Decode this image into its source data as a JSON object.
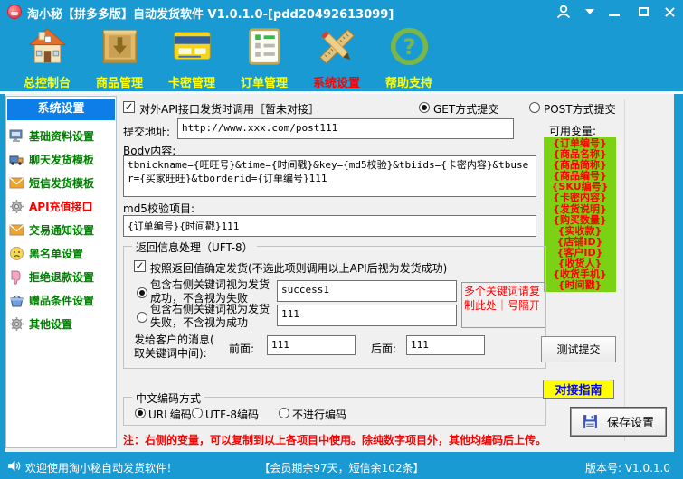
{
  "colors": {
    "titlebar_blue": "#199ad3",
    "sidebar_header_blue": "#0d7ee8",
    "variables_green": "#7bd114",
    "variable_text_red": "#ff0000",
    "nav_label_yellow": "#ffff00",
    "nav_selected_red": "#ff0000",
    "sidebar_item_green": "#008000",
    "guide_button_yellow": "#ffff00",
    "guide_button_text_blue": "#0000ff"
  },
  "window": {
    "title": "淘小秘【拼多多版】自动发货软件 V1.0.1.0-[pdd20492613099]"
  },
  "toolbar": {
    "items": [
      {
        "label": "总控制台",
        "icon": "home-icon",
        "selected": false
      },
      {
        "label": "商品管理",
        "icon": "goods-box-icon",
        "selected": false
      },
      {
        "label": "卡密管理",
        "icon": "card-icon",
        "selected": false
      },
      {
        "label": "订单管理",
        "icon": "order-list-icon",
        "selected": false
      },
      {
        "label": "系统设置",
        "icon": "tools-icon",
        "selected": true
      },
      {
        "label": "帮助支持",
        "icon": "help-icon",
        "selected": false
      }
    ]
  },
  "sidebar": {
    "header": "系统设置",
    "items": [
      {
        "label": "基础资料设置",
        "icon": "monitor-icon",
        "selected": false
      },
      {
        "label": "聊天发货模板",
        "icon": "truck-icon",
        "selected": false
      },
      {
        "label": "短信发货模板",
        "icon": "sms-envelope-icon",
        "selected": false
      },
      {
        "label": "API充值接口",
        "icon": "gear-icon",
        "selected": true
      },
      {
        "label": "交易通知设置",
        "icon": "notify-envelope-icon",
        "selected": false
      },
      {
        "label": "黑名单设置",
        "icon": "blacklist-face-icon",
        "selected": false
      },
      {
        "label": "拒绝退款设置",
        "icon": "thumbs-down-icon",
        "selected": false
      },
      {
        "label": "赠品条件设置",
        "icon": "gift-basket-icon",
        "selected": false
      },
      {
        "label": "其他设置",
        "icon": "gear-icon",
        "selected": false
      }
    ]
  },
  "content": {
    "api_checkbox_label": "对外API接口发货时调用［暂未对接］",
    "get_radio_label": "GET方式提交",
    "post_radio_label": "POST方式提交",
    "submit_address_label": "提交地址:",
    "submit_address_value": "http://www.xxx.com/post111",
    "variables_label": "可用变量:",
    "variables": [
      "{订单编号}",
      "{商品名称}",
      "{商品简称}",
      "{商品编号}",
      "{SKU编号}",
      "{卡密内容}",
      "{发货说明}",
      "{购买数量}",
      "{实收款}",
      "{店铺ID}",
      "{客户ID}",
      "{收货人}",
      "{收货手机}",
      "{时间戳}"
    ],
    "body_label": "Body内容:",
    "body_value": "tbnickname={旺旺号}&time={时间戳}&key={md5校验}&tbiids={卡密内容}&tbuser={买家旺旺}&tborderid={订单编号}111",
    "md5_label": "md5校验项目:",
    "md5_value": "{订单编号}{时间戳}111",
    "return_group": {
      "title": "返回信息处理（UFT-8）",
      "confirm_checkbox_label": "按照返回值确定发货(不选此项则调用以上API后视为发货成功)",
      "success_radio_line1": "包含右侧关键词视为发货",
      "success_radio_line2": "成功，不含视为失败",
      "success_keyword_value": "success1",
      "fail_radio_line1": "包含右侧关键词视为发货",
      "fail_radio_line2": "失败，不含视为成功",
      "fail_keyword_value": "111",
      "multi_keyword_note": "多个关键词请复制此处｜号隔开",
      "message_label_line1": "发给客户的消息(",
      "message_label_line2": "取关键词中间):",
      "front_label": "前面:",
      "front_value": "111",
      "back_label": "后面:",
      "back_value": "111"
    },
    "encoding_group": {
      "title": "中文编码方式",
      "option_url": "URL编码",
      "option_utf8": "UTF-8编码",
      "option_none": "不进行编码",
      "selected": "URL编码"
    },
    "note": "注：右侧的变量，可以复制到以上各项目中使用。除纯数字项目外，其他均编码后上传。",
    "test_button_label": "测试提交",
    "guide_button_label": "对接指南",
    "save_button_label": "保存设置"
  },
  "statusbar": {
    "welcome": "欢迎使用淘小秘自动发货软件！",
    "member_info": "【会员期余97天，短信余102条】",
    "version": "版本号: V1.0.1.0"
  }
}
